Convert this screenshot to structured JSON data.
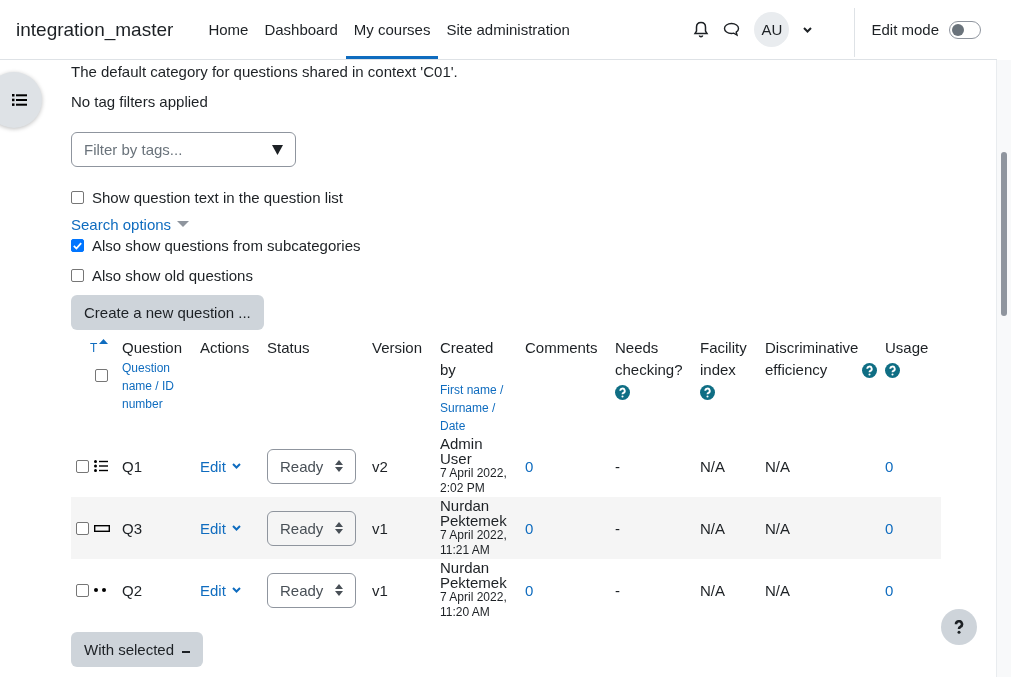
{
  "navbar": {
    "brand": "integration_master",
    "links": [
      {
        "label": "Home",
        "selected": false
      },
      {
        "label": "Dashboard",
        "selected": false
      },
      {
        "label": "My courses",
        "selected": true
      },
      {
        "label": "Site administration",
        "selected": false
      }
    ],
    "avatar": "AU",
    "edit_mode": {
      "label": "Edit mode",
      "on": false
    }
  },
  "category_note": "The default category for questions shared in context 'C01'.",
  "tag_note": "No tag filters applied",
  "tag_filter": {
    "placeholder": "Filter by tags..."
  },
  "show_text_option": {
    "label": "Show question text in the question list",
    "checked": false
  },
  "search_options_label": "Search options",
  "filter_options": [
    {
      "label": "Also show questions from subcategories",
      "checked": true
    },
    {
      "label": "Also show old questions",
      "checked": false
    }
  ],
  "create_button": "Create a new question ...",
  "table": {
    "type_header": "T",
    "question_header": {
      "title": "Question",
      "sort_links": "Question name / ID number"
    },
    "headers": [
      "Actions",
      "Status",
      "Version"
    ],
    "created_header": {
      "title": "Created by",
      "sort_links": "First name / Surname / Date"
    },
    "help_headers": [
      {
        "title": "Comments",
        "help": false
      },
      {
        "title": "Needs checking?",
        "help": true
      },
      {
        "title": "Facility index",
        "help": true
      },
      {
        "title": "Discriminative efficiency",
        "help": true
      },
      {
        "title": "Usage",
        "help": true
      }
    ],
    "select_all_checked": false,
    "rows": [
      {
        "checked": false,
        "kind": "multichoice",
        "name": "Q1",
        "action": "Edit",
        "status": "Ready",
        "version": "v2",
        "author": "Admin User",
        "date": "7 April 2022, 2:02 PM",
        "comments": "0",
        "needs_checking": "-",
        "facility": "N/A",
        "discrimination": "N/A",
        "usage": "0"
      },
      {
        "checked": false,
        "kind": "shortanswer",
        "name": "Q3",
        "action": "Edit",
        "status": "Ready",
        "version": "v1",
        "author": "Nurdan Pektemek",
        "date": "7 April 2022, 11:21 AM",
        "comments": "0",
        "needs_checking": "-",
        "facility": "N/A",
        "discrimination": "N/A",
        "usage": "0"
      },
      {
        "checked": false,
        "kind": "truefalse",
        "name": "Q2",
        "action": "Edit",
        "status": "Ready",
        "version": "v1",
        "author": "Nurdan Pektemek",
        "date": "7 April 2022, 11:20 AM",
        "comments": "0",
        "needs_checking": "-",
        "facility": "N/A",
        "discrimination": "N/A",
        "usage": "0"
      }
    ]
  },
  "with_selected_button": "With selected"
}
